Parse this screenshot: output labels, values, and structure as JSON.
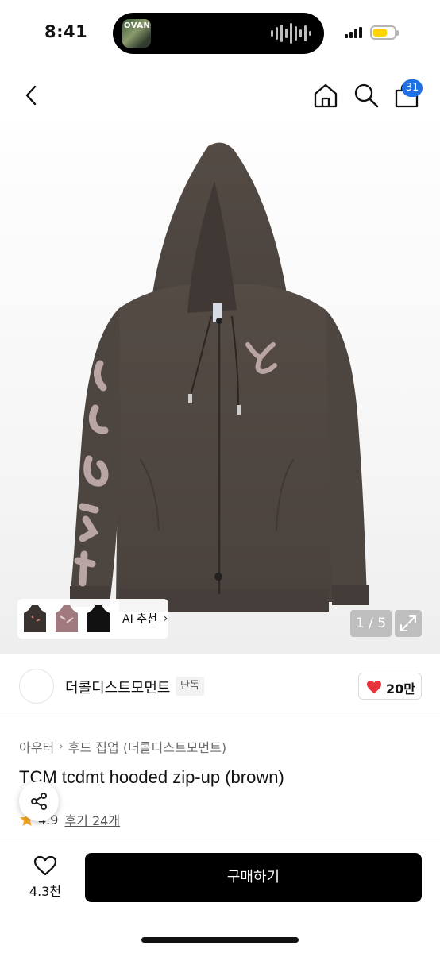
{
  "status_bar": {
    "time": "8:41",
    "now_playing_art_text": "OVAN",
    "battery_color": "#ffd400"
  },
  "header": {
    "icons": [
      "back-icon",
      "home-icon",
      "search-icon",
      "cart-icon"
    ],
    "cart_count": "31",
    "badge_color": "#1f6fe5"
  },
  "gallery": {
    "ai_recommend_label": "AI 추천",
    "page_indicator": "1 / 5",
    "product_color": "#5a524c",
    "print_color": "#b9a5a4"
  },
  "brand": {
    "name": "더콜디스트모먼트",
    "exclusive_badge": "단독",
    "like_count": "20만",
    "heart_color": "#e8313b"
  },
  "product": {
    "breadcrumb": [
      "아우터",
      "후드 집업 (더콜디스트모먼트)"
    ],
    "title": "TCM tcdmt hooded zip-up (brown)",
    "rating": "4.9",
    "review_link": "후기 24개",
    "star_color": "#f5a623"
  },
  "bottom_bar": {
    "wish_count": "4.3천",
    "buy_label": "구매하기"
  }
}
